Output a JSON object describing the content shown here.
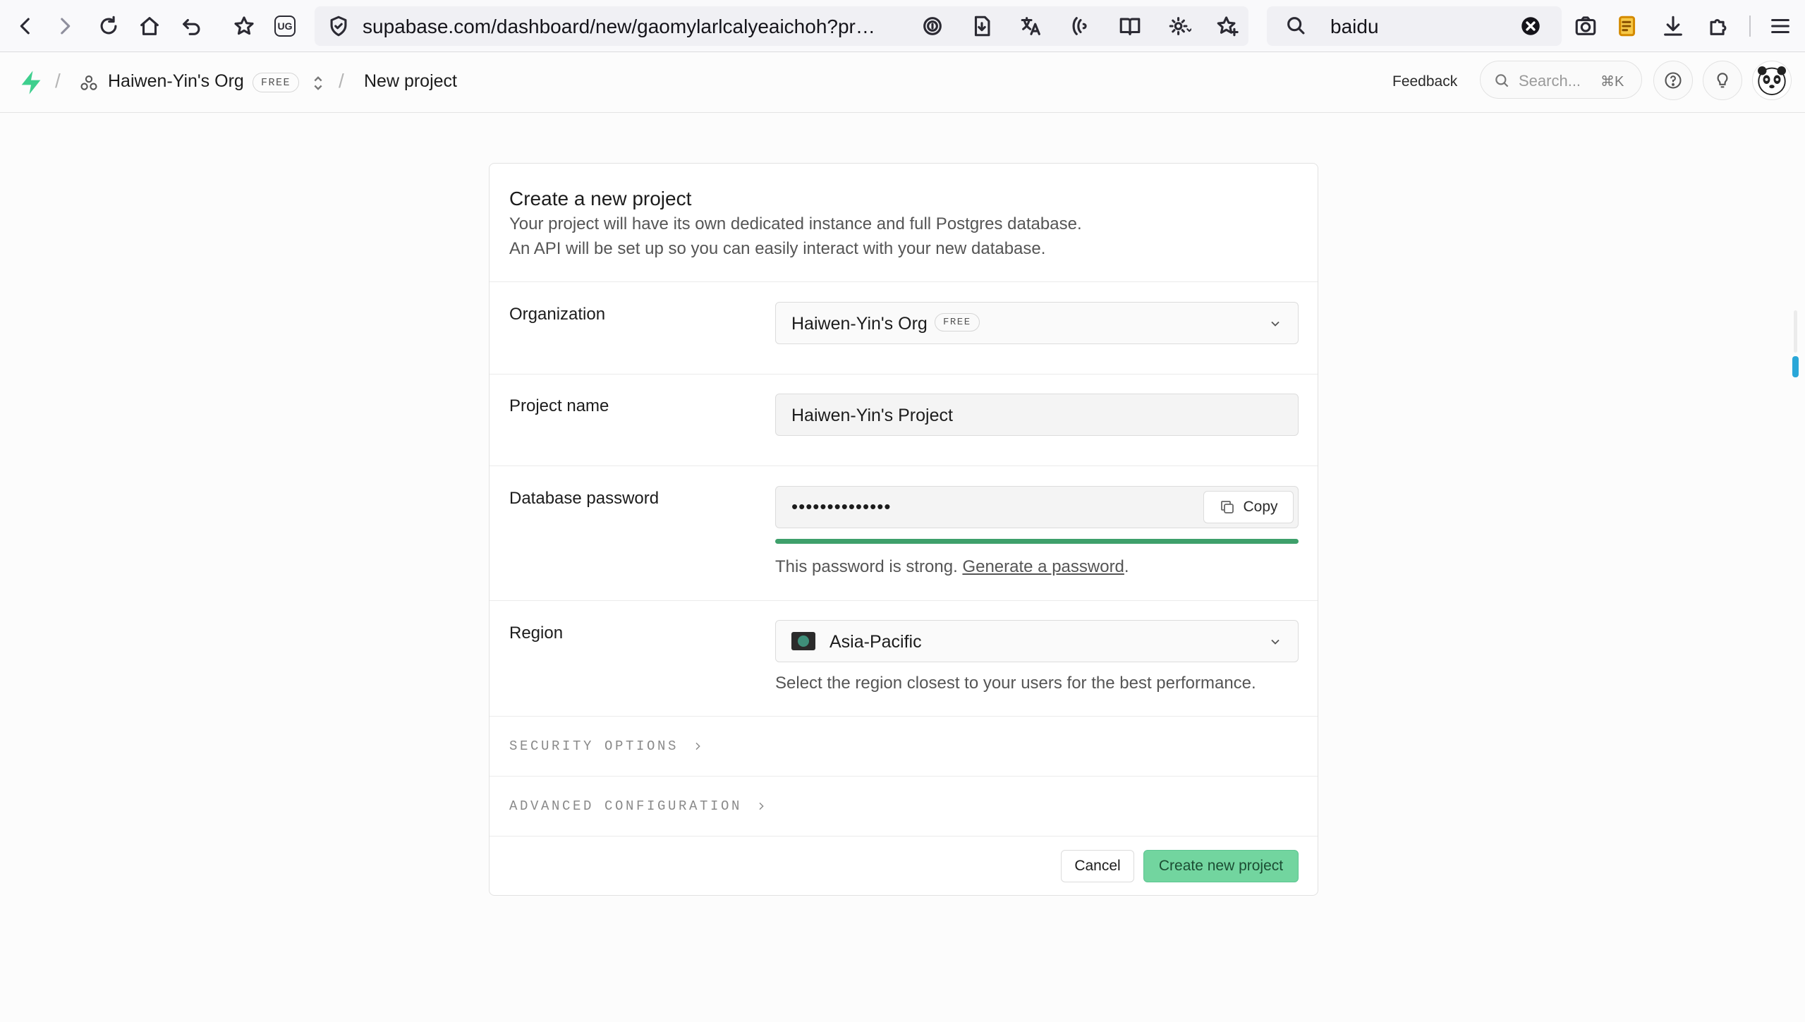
{
  "browser": {
    "url": "supabase.com/dashboard/new/gaomylarlcalyeaichoh?project...",
    "search_query": "baidu",
    "icons": [
      "back-icon",
      "forward-icon",
      "reload-icon",
      "home-icon",
      "undo-icon",
      "star-icon",
      "ug-icon",
      "shield-icon",
      "fingerprint-icon",
      "save-page-icon",
      "translate-icon",
      "read-aloud-icon",
      "reader-view-icon",
      "extensions-gear-icon",
      "favorite-add-icon",
      "search-icon",
      "clear-icon",
      "screenshot-icon",
      "notes-icon",
      "download-icon",
      "puzzle-icon",
      "menu-icon"
    ],
    "ug_label": "UG"
  },
  "header": {
    "org_name": "Haiwen-Yin's Org",
    "org_badge": "FREE",
    "separator": "/",
    "page": "New project",
    "feedback": "Feedback",
    "search_placeholder": "Search...",
    "search_shortcut": "⌘K"
  },
  "card": {
    "title": "Create a new project",
    "desc_line1": "Your project will have its own dedicated instance and full Postgres database.",
    "desc_line2": "An API will be set up so you can easily interact with your new database.",
    "organization": {
      "label": "Organization",
      "value": "Haiwen-Yin's Org",
      "badge": "FREE"
    },
    "project_name": {
      "label": "Project name",
      "value": "Haiwen-Yin's Project"
    },
    "password": {
      "label": "Database password",
      "value": "••••••••••••••",
      "copy_label": "Copy",
      "strength_text": "This password is strong.",
      "generate_link": "Generate a password",
      "generate_suffix": ".",
      "strength": 1.0
    },
    "region": {
      "label": "Region",
      "value": "Asia-Pacific",
      "helper": "Select the region closest to your users for the best performance."
    },
    "security_options": "SECURITY OPTIONS",
    "advanced_configuration": "ADVANCED CONFIGURATION",
    "cancel_label": "Cancel",
    "create_label": "Create new project"
  },
  "colors": {
    "brand_green": "#3ecf8e",
    "primary_button": "#72d59f",
    "strength_bar": "#3ea06b"
  }
}
